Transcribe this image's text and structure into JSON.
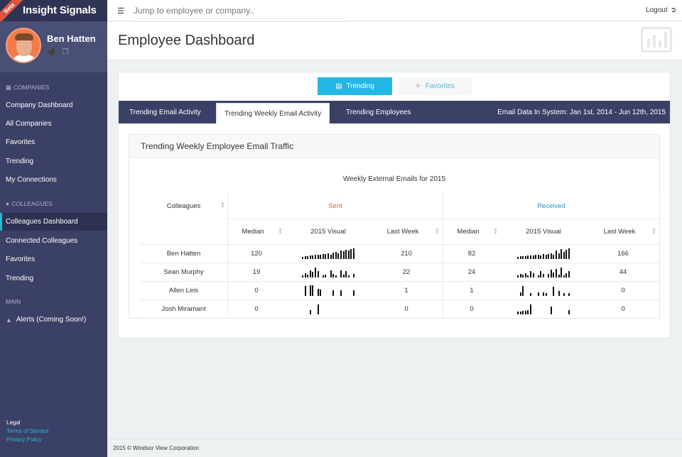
{
  "brand": {
    "title": "Insight Signals",
    "badge": "Beta"
  },
  "profile": {
    "name": "Ben Hatten"
  },
  "nav": {
    "companies_header": "Companies",
    "companies": [
      "Company Dashboard",
      "All Companies",
      "Favorites",
      "Trending",
      "My Connections"
    ],
    "colleagues_header": "Colleagues",
    "colleagues": [
      "Colleagues Dashboard",
      "Connected Colleagues",
      "Favorites",
      "Trending"
    ],
    "main_header": "Main",
    "main": [
      "Alerts (Coming Soon!)"
    ],
    "active": "Colleagues Dashboard"
  },
  "legal": {
    "label": "Legal",
    "terms": "Terms of Service",
    "privacy": "Privacy Policy"
  },
  "topbar": {
    "search_placeholder": "Jump to employee or company..",
    "logout": "Logout"
  },
  "page": {
    "title": "Employee Dashboard"
  },
  "toggle": {
    "trending": "Trending",
    "favorites": "Favorites"
  },
  "tabs": {
    "items": [
      "Trending Email Activity",
      "Trending Weekly Email Activity",
      "Trending Employees"
    ],
    "active_index": 1,
    "info": "Email Data In System: Jan 1st, 2014 - Jun 12th, 2015"
  },
  "card": {
    "title": "Trending Weekly Employee Email Traffic",
    "chart_title": "Weekly External Emails for 2015",
    "colleagues_header": "Colleagues",
    "sent_header": "Sent",
    "received_header": "Received",
    "sub_headers": [
      "Median",
      "2015 Visual",
      "Last Week",
      "Median",
      "2015 Visual",
      "Last Week"
    ],
    "rows": [
      {
        "name": "Ben Hatten",
        "sent_median": "120",
        "sent_last": "210",
        "recv_median": "82",
        "recv_last": "166",
        "sent_visual": [
          3,
          4,
          4,
          5,
          5,
          6,
          6,
          6,
          7,
          7,
          8,
          6,
          9,
          10,
          8,
          12,
          11,
          13,
          12,
          14,
          15
        ],
        "recv_visual": [
          3,
          4,
          4,
          4,
          5,
          5,
          5,
          6,
          6,
          5,
          7,
          6,
          7,
          8,
          6,
          12,
          8,
          14,
          10,
          13,
          15
        ]
      },
      {
        "name": "Sean Murphy",
        "sent_median": "19",
        "sent_last": "22",
        "recv_median": "24",
        "recv_last": "44",
        "sent_visual": [
          3,
          6,
          4,
          10,
          8,
          14,
          9,
          0,
          3,
          4,
          0,
          10,
          5,
          3,
          0,
          10,
          4,
          9,
          3,
          0,
          5
        ],
        "recv_visual": [
          3,
          5,
          4,
          6,
          3,
          9,
          6,
          0,
          3,
          9,
          5,
          0,
          5,
          11,
          7,
          12,
          4,
          14,
          3,
          6,
          9
        ]
      },
      {
        "name": "Allen Leis",
        "sent_median": "0",
        "sent_last": "1",
        "recv_median": "1",
        "recv_last": "0",
        "sent_visual": [
          0,
          14,
          0,
          15,
          15,
          0,
          10,
          9,
          0,
          0,
          0,
          0,
          8,
          0,
          0,
          8,
          0,
          0,
          0,
          0,
          8
        ],
        "recv_visual": [
          0,
          5,
          14,
          0,
          0,
          4,
          0,
          0,
          5,
          0,
          5,
          4,
          0,
          0,
          13,
          0,
          7,
          0,
          4,
          0,
          4
        ]
      },
      {
        "name": "Josh Miramant",
        "sent_median": "0",
        "sent_last": "0",
        "recv_median": "0",
        "recv_last": "0",
        "sent_visual": [
          0,
          0,
          0,
          6,
          0,
          0,
          14,
          0,
          0,
          0,
          0,
          0,
          0,
          0,
          0,
          0,
          0,
          0,
          0,
          0,
          0
        ],
        "recv_visual": [
          4,
          4,
          5,
          5,
          6,
          14,
          0,
          0,
          0,
          0,
          0,
          0,
          0,
          11,
          0,
          0,
          0,
          0,
          0,
          0,
          6
        ]
      }
    ]
  },
  "footer": {
    "text": "2015 © Windsor View Corporation"
  },
  "colors": {
    "sidebar": "#3b4066",
    "accent": "#23b7e5",
    "sent": "#e0533f",
    "received": "#2f8fc4"
  }
}
